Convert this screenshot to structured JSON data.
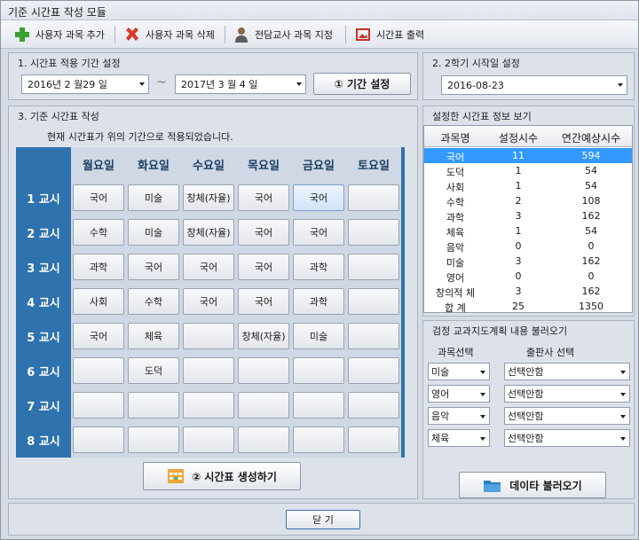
{
  "window": {
    "title": "기준 시간표 작성 모듈"
  },
  "toolbar": {
    "add_label": "사용자 과목 추가",
    "delete_label": "사용자 과목 삭제",
    "assign_label": "전담교사 과목 지정",
    "print_label": "시간표 출력"
  },
  "period_section": {
    "title": "1. 시간표 적용 기간 설정",
    "start": "2016년 2 월29 일",
    "tilde": "~",
    "end": "2017년 3 월 4 일",
    "button": "① 기간 설정"
  },
  "semester_section": {
    "title": "2. 2학기 시작일 설정",
    "date": "2016-08-23"
  },
  "timetable_section": {
    "title": "3. 기준 시간표 작성",
    "notice": "현재 시간표가 위의 기간으로 적용되었습니다.",
    "days": [
      "월요일",
      "화요일",
      "수요일",
      "목요일",
      "금요일",
      "토요일"
    ],
    "periods": [
      "1 교시",
      "2 교시",
      "3 교시",
      "4 교시",
      "5 교시",
      "6 교시",
      "7 교시",
      "8 교시"
    ],
    "rows": [
      [
        "국어",
        "미술",
        "창체(자율)",
        "국어",
        "국어",
        ""
      ],
      [
        "수학",
        "미술",
        "창체(자율)",
        "국어",
        "국어",
        ""
      ],
      [
        "과학",
        "국어",
        "국어",
        "국어",
        "과학",
        ""
      ],
      [
        "사회",
        "수학",
        "국어",
        "국어",
        "과학",
        ""
      ],
      [
        "국어",
        "체육",
        "",
        "창체(자율)",
        "미술",
        ""
      ],
      [
        "",
        "도덕",
        "",
        "",
        "",
        ""
      ],
      [
        "",
        "",
        "",
        "",
        "",
        ""
      ],
      [
        "",
        "",
        "",
        "",
        "",
        ""
      ]
    ],
    "generate_button": "② 시간표 생성하기"
  },
  "info_section": {
    "title": "설정한 시간표 정보 보기",
    "headers": [
      "과목명",
      "설정시수",
      "연간예상시수"
    ],
    "rows": [
      [
        "국어",
        "11",
        "594"
      ],
      [
        "도덕",
        "1",
        "54"
      ],
      [
        "사회",
        "1",
        "54"
      ],
      [
        "수학",
        "2",
        "108"
      ],
      [
        "과학",
        "3",
        "162"
      ],
      [
        "체육",
        "1",
        "54"
      ],
      [
        "음악",
        "0",
        "0"
      ],
      [
        "미술",
        "3",
        "162"
      ],
      [
        "영어",
        "0",
        "0"
      ],
      [
        "창의적 체",
        "3",
        "162"
      ],
      [
        "합  계",
        "25",
        "1350"
      ]
    ]
  },
  "plan_section": {
    "title": "검정 교과지도계획 내용 불러오기",
    "subject_header": "과목선택",
    "publisher_header": "출판사 선택",
    "rows": [
      {
        "subject": "미술",
        "publisher": "선택안함"
      },
      {
        "subject": "영어",
        "publisher": "선택안함"
      },
      {
        "subject": "음악",
        "publisher": "선택안함"
      },
      {
        "subject": "체육",
        "publisher": "선택안함"
      }
    ],
    "load_button": "데이타 불러오기"
  },
  "footer": {
    "close_button": "닫 기"
  }
}
